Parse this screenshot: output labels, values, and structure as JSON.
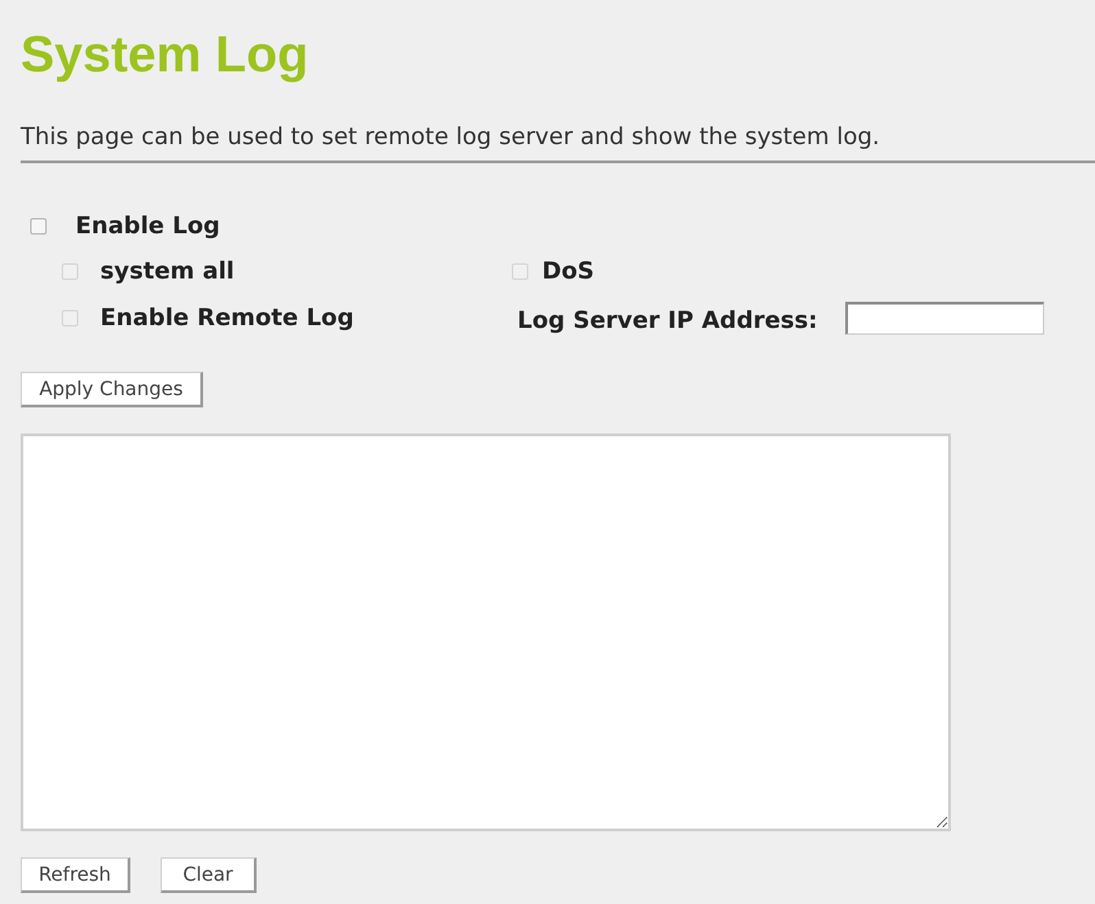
{
  "title": "System Log",
  "description": "This page can be used to set remote log server and show the system log.",
  "enable_log": {
    "label": "Enable Log",
    "checked": false,
    "disabled": false
  },
  "options": [
    {
      "label": "system all",
      "checked": false,
      "disabled": true
    },
    {
      "label": "DoS",
      "checked": false,
      "disabled": true
    },
    {
      "label": "Enable Remote Log",
      "checked": false,
      "disabled": true
    }
  ],
  "log_server_ip": {
    "label": "Log Server IP Address:"
  },
  "apply_button": "Apply Changes",
  "buttons": [
    "Refresh",
    "Clear"
  ]
}
